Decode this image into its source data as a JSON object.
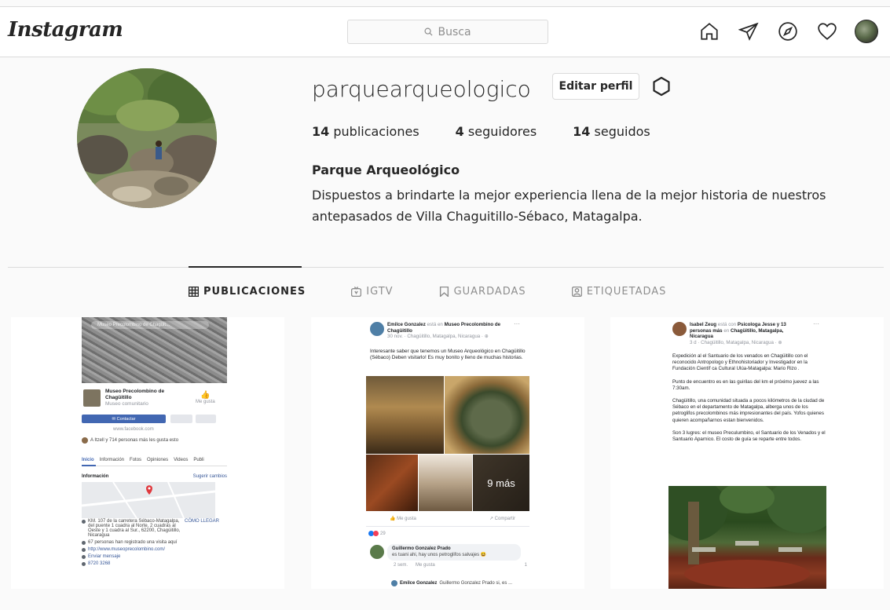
{
  "app": {
    "logo": "Instagram"
  },
  "search": {
    "placeholder": "Busca"
  },
  "nav_icons": [
    "home-icon",
    "direct-icon",
    "explore-icon",
    "activity-heart-icon",
    "profile-avatar"
  ],
  "profile": {
    "username": "parquearqueologico",
    "edit_label": "Editar perfil",
    "stats": {
      "posts_count": "14",
      "posts_label": "publicaciones",
      "followers_count": "4",
      "followers_label": "seguidores",
      "following_count": "14",
      "following_label": "seguidos"
    },
    "full_name": "Parque Arqueológico",
    "bio": "Dispuestos a brindarte la mejor experiencia llena de la mejor historia de nuestros antepasados de Villa Chaguitillo-Sébaco, Matagalpa."
  },
  "tabs": [
    {
      "label": "PUBLICACIONES",
      "icon": "grid-icon",
      "active": true
    },
    {
      "label": "IGTV",
      "icon": "igtv-icon",
      "active": false
    },
    {
      "label": "GUARDADAS",
      "icon": "bookmark-icon",
      "active": false
    },
    {
      "label": "ETIQUETADAS",
      "icon": "tagged-icon",
      "active": false
    }
  ],
  "posts": {
    "p1": {
      "search_text": "Museo Precolombino de Chagüit...",
      "page_name": "Museo Precolombino de Chagüitillo",
      "page_category": "Museo comunitario",
      "like_label": "Me gusta",
      "contact_label": "Contactar",
      "url_short": "www.facebook.com",
      "friends_text": "A Itzell y 714 personas más les gusta esto",
      "page_tabs": [
        "Inicio",
        "Información",
        "Fotos",
        "Opiniones",
        "Videos",
        "Publi"
      ],
      "info_label": "Información",
      "suggest_label": "Sugerir cambios",
      "address": "KM. 107 de la carretera Sébaco-Matagalpa, del puente 1 cuadra al Norte, 2 cuadras al Oeste y 1 cuadra al Sur., 62200, Chagüitillo, Nicaragua",
      "directions": "CÓMO LLEGAR",
      "visits": "67 personas han registrado una visita aquí",
      "website": "http://www.museoprecolombino.com/",
      "send_message": "Enviar mensaje",
      "phone": "8720 3268"
    },
    "p2": {
      "author": "Emilce Gonzalez",
      "is_at": "está en",
      "place": "Museo Precolombino de Chagüitillo",
      "meta": "30 nov. · Chagüitillo, Matagalpa, Nicaragua · ",
      "body": "Interesante saber que tenemos un Museo Arqueológico en Chagüitillo (Sébaco) Deben visitarlo! Es muy bonito y lleno de muchas historias.",
      "more_photos": "9 más",
      "like": "Me gusta",
      "share": "Compartir",
      "reactions": "29",
      "commenter": "Guillermo Gonzalez Prado",
      "comment": "es tuani ahi, hay unos petroglifos salvajes",
      "comment_time": "2 sem.",
      "comment_like": "Me gusta",
      "comment_reacts": "1",
      "reply_author": "Emilce Gonzalez",
      "reply_text": "Guillermo Gonzalez Prado si, es ..."
    },
    "p3": {
      "author": "Isabel Zeug",
      "is_with": "está con",
      "with_names": "Psicologa Jesse",
      "and_others": "y 13 personas más",
      "in": "en",
      "place": "Chagüitillo, Matagalpa, Nicaragua",
      "meta": "3 d · Chagüitillo, Matagalpa, Nicaragua · ",
      "paragraphs": [
        "Expedición al el Santuario de los venados en Chagüitillo con el reconocido Antropologo y Ethnohistoriador y Investigador en la Fundación Científ ca Cultural Ulúa-Matagalpa: Mario Rizo .",
        "Punto de encuentro es en las guirilas del km el próximo juevez a las 7:30am.",
        "Chagüitillo, una comunidad situada a pocos kilómetros de la ciudad de Sébaco en el departamento de Matagalpa, alberga unos de los petroglifos precolombinos más impresionantes del país. Yofos quienes quieren acompañarnos estan bienvenidos.",
        "Son 3 lugres: el museo Preculumbino, el Santuario de los Venados y el Santuario Aparnico. El costo de guía se reparte entre todos."
      ]
    }
  },
  "colors": {
    "background": "#fafafa",
    "border": "#dbdbdb",
    "text": "#262626",
    "muted": "#8e8e8e",
    "facebook_blue": "#4267b2"
  }
}
